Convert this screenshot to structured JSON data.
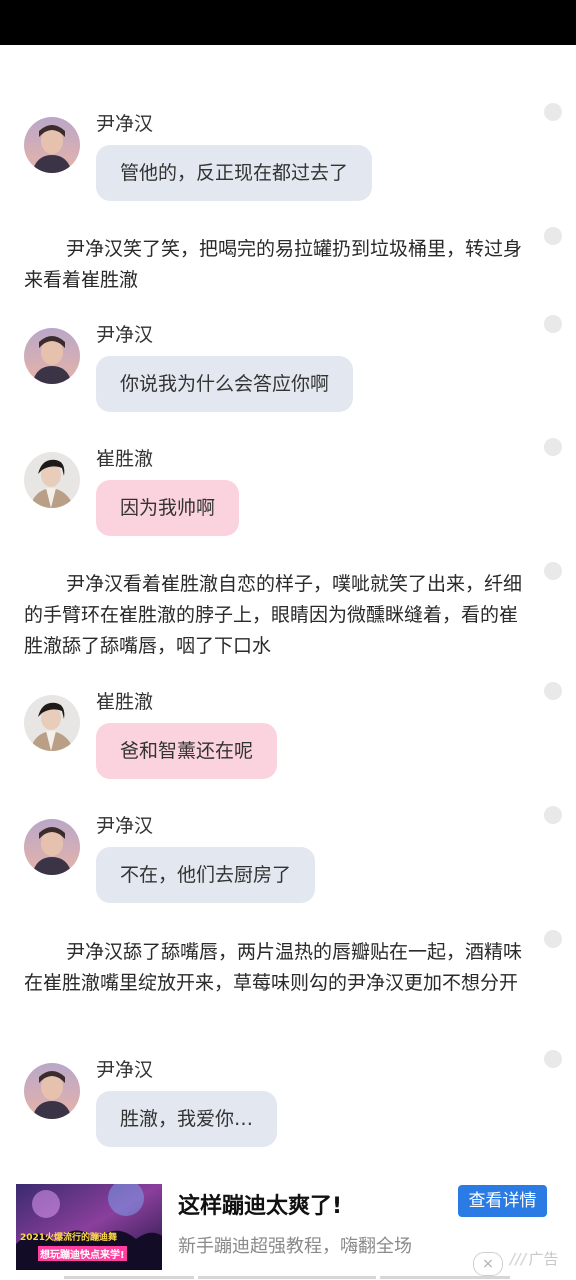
{
  "messages": [
    {
      "type": "bubble",
      "speaker": "尹净汉",
      "text": "管他的，反正现在都过去了",
      "color": "blue",
      "avatar": "yoon"
    },
    {
      "type": "narration",
      "text": "尹净汉笑了笑，把喝完的易拉罐扔到垃圾桶里，转过身来看着崔胜澈"
    },
    {
      "type": "bubble",
      "speaker": "尹净汉",
      "text": "你说我为什么会答应你啊",
      "color": "blue",
      "avatar": "yoon"
    },
    {
      "type": "bubble",
      "speaker": "崔胜澈",
      "text": "因为我帅啊",
      "color": "pink",
      "avatar": "choi"
    },
    {
      "type": "narration",
      "text": "尹净汉看着崔胜澈自恋的样子，噗呲就笑了出来，纤细的手臂环在崔胜澈的脖子上，眼睛因为微醺眯缝着，看的崔胜澈舔了舔嘴唇，咽了下口水"
    },
    {
      "type": "bubble",
      "speaker": "崔胜澈",
      "text": "爸和智薰还在呢",
      "color": "pink",
      "avatar": "choi"
    },
    {
      "type": "bubble",
      "speaker": "尹净汉",
      "text": "不在，他们去厨房了",
      "color": "blue",
      "avatar": "yoon"
    },
    {
      "type": "narration",
      "text": "尹净汉舔了舔嘴唇，两片温热的唇瓣贴在一起，酒精味在崔胜澈嘴里绽放开来，草莓味则勾的尹净汉更加不想分开"
    },
    {
      "type": "bubble",
      "speaker": "尹净汉",
      "text": "胜澈，我爱你…",
      "color": "blue",
      "avatar": "yoon"
    }
  ],
  "ad": {
    "title": "这样蹦迪太爽了!",
    "subtitle": "新手蹦迪超强教程，嗨翻全场",
    "button": "查看详情",
    "close": "×",
    "tag": "广告",
    "image_text_1": "2021火爆流行的蹦迪舞",
    "image_text_2": "想玩蹦迪快点来学!"
  },
  "colors": {
    "bubble_blue": "#e3e8f0",
    "bubble_pink": "#fbd3df",
    "ad_button": "#2a7be4"
  }
}
